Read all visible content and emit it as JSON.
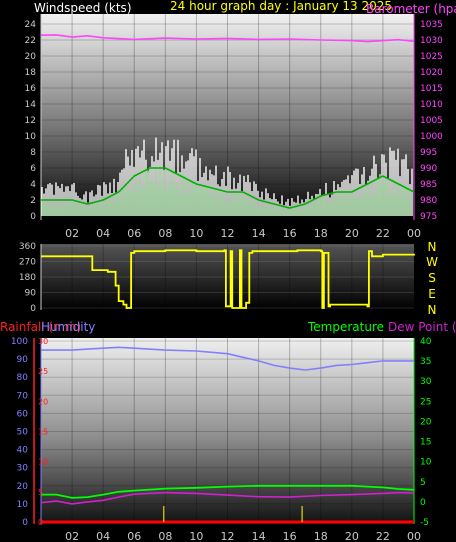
{
  "header": {
    "left_title": "Windspeed (kts)",
    "center_title": "24 hour graph day :  January 13 2025",
    "right_title": "Barometer (hpa)"
  },
  "colors": {
    "wind_gust": "#ffffff",
    "wind_avg": "#b8f0b8",
    "wind_avg_line": "#00b000",
    "barometer": "#ff44ff",
    "direction": "#ffff00",
    "rain_axis": "#ff2020",
    "humidity": "#8080ff",
    "temperature": "#00ff00",
    "dewpoint": "#d020d0",
    "rain_bar": "#ff0000",
    "tick_yellow": "#dddd00",
    "axis_text": "#c8c8c8"
  },
  "chart_data": [
    {
      "type": "line",
      "panel": "wind_barometer",
      "x_ticks": [
        "02",
        "04",
        "06",
        "08",
        "10",
        "12",
        "14",
        "16",
        "18",
        "20",
        "22",
        "00"
      ],
      "xlim": [
        0,
        24
      ],
      "left_axis": {
        "label": "Windspeed (kts)",
        "ticks": [
          "0",
          "2",
          "4",
          "6",
          "8",
          "10",
          "12",
          "14",
          "16",
          "18",
          "20",
          "22",
          "24"
        ],
        "ylim": [
          0,
          24.5
        ]
      },
      "right_axis": {
        "label": "Barometer (hpa)",
        "ticks": [
          "975",
          "980",
          "985",
          "990",
          "995",
          "1000",
          "1005",
          "1010",
          "1015",
          "1020",
          "1025",
          "1030",
          "1035"
        ],
        "ylim": [
          975,
          1037.5
        ]
      },
      "series": [
        {
          "name": "Barometer (hpa)",
          "axis": "right",
          "x": [
            0,
            1,
            2,
            3,
            4,
            6,
            8,
            10,
            12,
            14,
            16,
            18,
            20,
            21,
            22,
            23,
            24
          ],
          "y": [
            1031.5,
            1031.6,
            1030.9,
            1031.3,
            1030.7,
            1030.2,
            1030.6,
            1030.3,
            1030.5,
            1030.2,
            1030.3,
            1030.0,
            1029.8,
            1029.5,
            1029.8,
            1030.1,
            1029.6
          ]
        },
        {
          "name": "gust",
          "axis": "left",
          "x": [
            0,
            1,
            2,
            3,
            4,
            5,
            5.5,
            6,
            7,
            8,
            9,
            10,
            11,
            12,
            13,
            14,
            15,
            16,
            17,
            18,
            19,
            20,
            21,
            22,
            23,
            24
          ],
          "y": [
            4,
            4,
            4,
            3,
            4,
            5,
            9,
            9,
            10,
            9,
            9,
            8,
            6,
            6,
            5,
            4,
            3,
            2,
            3,
            4,
            4,
            5,
            7,
            8,
            8,
            6
          ]
        },
        {
          "name": "average",
          "axis": "left",
          "x": [
            0,
            1,
            2,
            3,
            4,
            5,
            5.5,
            6,
            7,
            8,
            9,
            10,
            11,
            12,
            13,
            14,
            15,
            16,
            17,
            18,
            19,
            20,
            21,
            22,
            23,
            24
          ],
          "y": [
            2,
            2,
            2,
            1.5,
            2,
            3,
            4,
            5,
            6,
            6,
            5,
            4,
            3.5,
            3,
            3,
            2,
            1.5,
            1,
            1.5,
            2.5,
            3,
            3,
            4,
            5,
            4,
            3
          ]
        }
      ]
    },
    {
      "type": "line",
      "panel": "wind_direction",
      "x_ticks": [
        "02",
        "04",
        "06",
        "08",
        "10",
        "12",
        "14",
        "16",
        "18",
        "20",
        "22",
        "00"
      ],
      "xlim": [
        0,
        24
      ],
      "left_axis": {
        "ticks": [
          "0",
          "90",
          "180",
          "270",
          "360"
        ],
        "ylim": [
          0,
          360
        ]
      },
      "right_labels": [
        "N",
        "W",
        "S",
        "E",
        "N"
      ],
      "series": [
        {
          "name": "direction",
          "x": [
            0,
            0.5,
            3.2,
            3.3,
            4.3,
            4.8,
            5.0,
            5.3,
            5.5,
            5.8,
            6,
            8,
            10,
            11.8,
            11.9,
            12.2,
            12.3,
            12.8,
            12.9,
            13.2,
            13.4,
            13.6,
            16,
            16.5,
            18,
            18.1,
            18.2,
            18.5,
            18.6,
            20.5,
            21,
            21.1,
            21.3,
            22,
            24
          ],
          "y": [
            300,
            300,
            300,
            220,
            210,
            130,
            40,
            20,
            0,
            320,
            330,
            335,
            330,
            335,
            10,
            330,
            0,
            335,
            0,
            30,
            320,
            330,
            330,
            335,
            330,
            0,
            320,
            10,
            20,
            20,
            10,
            330,
            300,
            310,
            305
          ]
        }
      ]
    },
    {
      "type": "line",
      "panel": "temperature_humidity_rain",
      "x_ticks": [
        "02",
        "04",
        "06",
        "08",
        "10",
        "12",
        "14",
        "16",
        "18",
        "20",
        "22",
        "00"
      ],
      "xlim": [
        0,
        24
      ],
      "axes": [
        {
          "label": "Rainfall (mm)",
          "ticks": [
            "0",
            "5",
            "10",
            "15",
            "20",
            "25",
            "30"
          ]
        },
        {
          "label": "Humidity",
          "ticks": [
            "0",
            "10",
            "20",
            "30",
            "40",
            "50",
            "60",
            "70",
            "80",
            "90",
            "100"
          ],
          "ylim": [
            0,
            100
          ]
        },
        {
          "label": "Temperature",
          "ticks": [
            "-5",
            "0",
            "5",
            "10",
            "15",
            "20",
            "25",
            "30",
            "35",
            "40"
          ],
          "ylim": [
            -5,
            40
          ]
        },
        {
          "label": "Dew Point (C)"
        }
      ],
      "series": [
        {
          "name": "Humidity",
          "axis": "Humidity",
          "x": [
            0,
            2,
            3,
            4,
            5,
            6,
            8,
            10,
            12,
            13,
            14,
            15,
            16,
            17,
            18,
            19,
            20,
            21,
            22,
            23,
            24
          ],
          "y": [
            95,
            95,
            95.5,
            96,
            96.5,
            96,
            95,
            94.5,
            93,
            91,
            89,
            86.5,
            85,
            84,
            85,
            86.5,
            87,
            88,
            89,
            89,
            89
          ]
        },
        {
          "name": "Temperature",
          "axis": "Temperature",
          "x": [
            0,
            1,
            2,
            3,
            4,
            5,
            6,
            8,
            10,
            12,
            14,
            16,
            18,
            20,
            22,
            23,
            24
          ],
          "y": [
            1.8,
            1.8,
            1.0,
            1.2,
            1.8,
            2.5,
            2.8,
            3.3,
            3.5,
            3.8,
            4.0,
            4.0,
            4.0,
            4.0,
            3.6,
            3.2,
            3.0
          ]
        },
        {
          "name": "Dew Point (C)",
          "axis": "Temperature",
          "x": [
            0,
            1,
            2,
            3,
            4,
            5,
            6,
            8,
            10,
            12,
            14,
            16,
            18,
            20,
            22,
            23,
            24
          ],
          "y": [
            -0.2,
            0.2,
            -0.5,
            0.0,
            0.4,
            1.2,
            1.9,
            2.3,
            2.1,
            1.7,
            1.3,
            1.2,
            1.6,
            1.8,
            2.1,
            2.3,
            2.2
          ]
        },
        {
          "name": "Rainfall (mm)",
          "axis": "Rainfall (mm)",
          "x": [
            0,
            24
          ],
          "y": [
            0,
            0
          ]
        }
      ],
      "markers": [
        {
          "x": 7.9
        },
        {
          "x": 16.8
        }
      ]
    }
  ]
}
